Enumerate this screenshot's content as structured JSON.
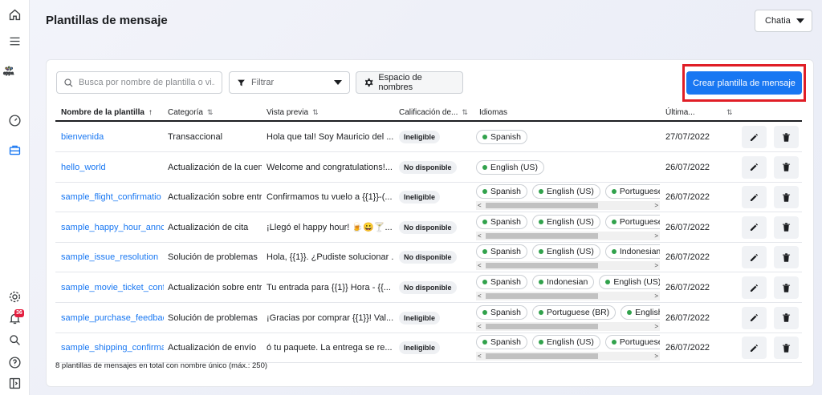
{
  "header": {
    "title": "Plantillas de mensaje",
    "account": "Chatia"
  },
  "toolbar": {
    "search_placeholder": "Busca por nombre de plantilla o vi...",
    "filter_label": "Filtrar",
    "namespace_label": "Espacio de nombres",
    "create_label": "Crear plantilla de mensaje"
  },
  "table": {
    "columns": {
      "name": "Nombre de la plantilla",
      "category": "Categoría",
      "preview": "Vista previa",
      "score": "Calificación de...",
      "languages": "Idiomas",
      "updated": "Última..."
    },
    "rows": [
      {
        "name": "bienvenida",
        "category": "Transaccional",
        "preview": "Hola que tal! Soy Mauricio del ...",
        "score": "Ineligible",
        "languages": [
          "Spanish"
        ],
        "scroll": false,
        "date": "27/07/2022"
      },
      {
        "name": "hello_world",
        "category": "Actualización de la cuen",
        "preview": "Welcome and congratulations!...",
        "score": "No disponible",
        "languages": [
          "English (US)"
        ],
        "scroll": false,
        "date": "26/07/2022"
      },
      {
        "name": "sample_flight_confirmatio",
        "category": "Actualización sobre entr",
        "preview": "Confirmamos tu vuelo a {{1}}-(...",
        "score": "Ineligible",
        "languages": [
          "Spanish",
          "English (US)",
          "Portuguese (BR"
        ],
        "scroll": true,
        "date": "26/07/2022"
      },
      {
        "name": "sample_happy_hour_annc",
        "category": "Actualización de cita",
        "preview": "¡Llegó el happy hour! 🍺😀🍸...",
        "score": "No disponible",
        "languages": [
          "Spanish",
          "English (US)",
          "Portuguese (BR"
        ],
        "scroll": true,
        "date": "26/07/2022"
      },
      {
        "name": "sample_issue_resolution",
        "category": "Solución de problemas",
        "preview": "Hola, {{1}}. ¿Pudiste solucionar ...",
        "score": "No disponible",
        "languages": [
          "Spanish",
          "English (US)",
          "Indonesian"
        ],
        "scroll": true,
        "date": "26/07/2022"
      },
      {
        "name": "sample_movie_ticket_conf",
        "category": "Actualización sobre entr",
        "preview": "Tu entrada para {{1}} Hora - {{...",
        "score": "No disponible",
        "languages": [
          "Spanish",
          "Indonesian",
          "English (US)"
        ],
        "scroll": true,
        "date": "26/07/2022"
      },
      {
        "name": "sample_purchase_feedbac",
        "category": "Solución de problemas",
        "preview": "¡Gracias por comprar {{1}}! Val...",
        "score": "Ineligible",
        "languages": [
          "Spanish",
          "Portuguese (BR)",
          "English (US"
        ],
        "scroll": true,
        "date": "26/07/2022"
      },
      {
        "name": "sample_shipping_confirma",
        "category": "Actualización de envío",
        "preview": "ó tu paquete. La entrega se re...",
        "score": "Ineligible",
        "languages": [
          "Spanish",
          "English (US)",
          "Portuguese (BR"
        ],
        "scroll": true,
        "date": "26/07/2022"
      }
    ]
  },
  "footer": {
    "note": "8 plantillas de mensajes en total con nombre único (máx.: 250)"
  },
  "notifications": {
    "count": "36"
  },
  "colors": {
    "accent": "#1877f2",
    "highlight": "#e01e26",
    "status_dot": "#31a24c"
  },
  "icons": {
    "edit": "pencil-icon",
    "delete": "trash-icon"
  }
}
